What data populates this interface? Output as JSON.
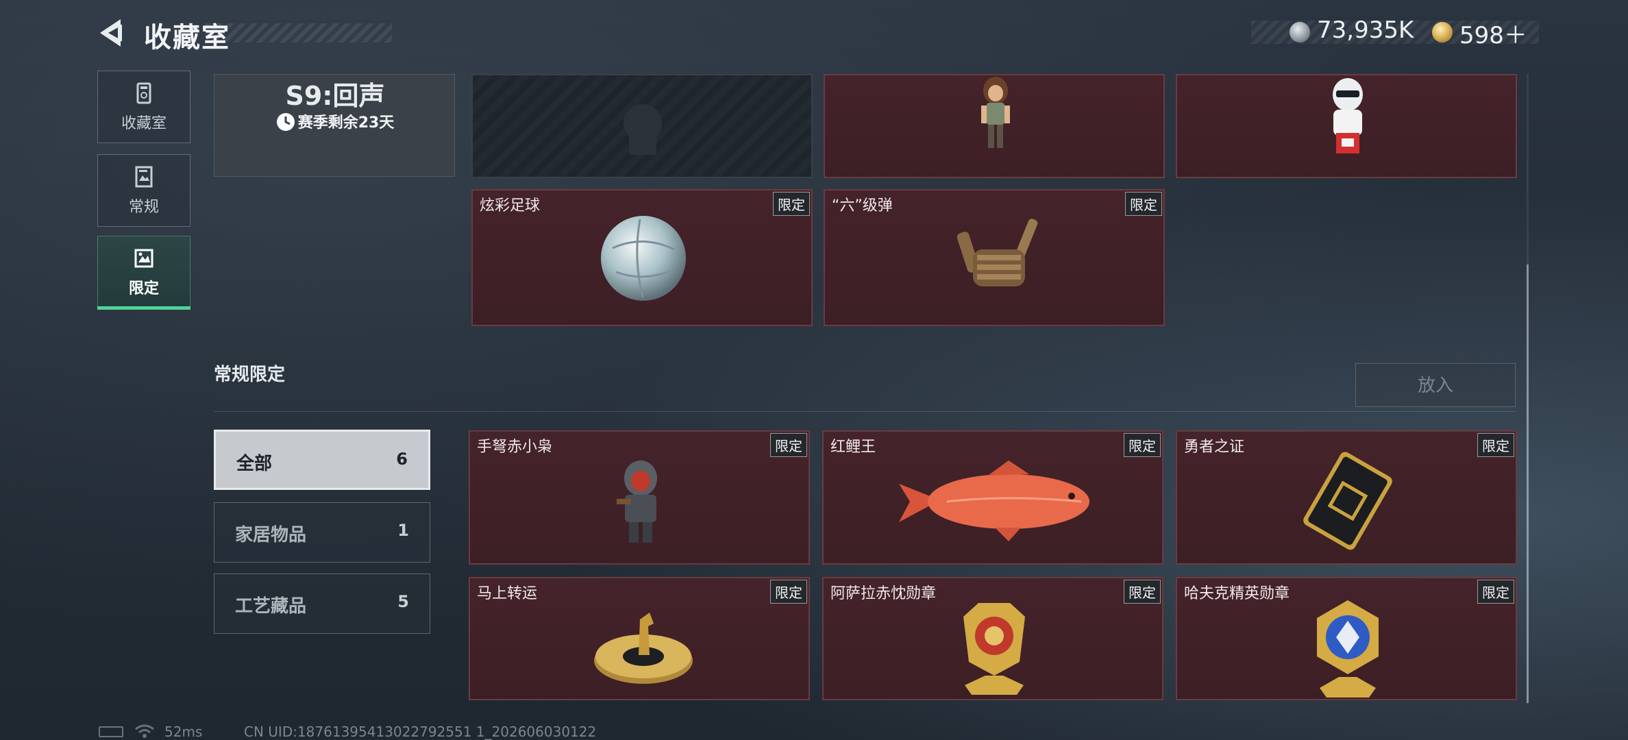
{
  "header": {
    "title": "收藏室",
    "currencies": [
      {
        "icon": "silver-coin-icon",
        "value": "73,935K"
      },
      {
        "icon": "gold-coin-icon",
        "value": "598＋"
      }
    ]
  },
  "nav": {
    "items": [
      {
        "label": "收藏室",
        "icon": "collection-icon"
      },
      {
        "label": "常规",
        "icon": "book-icon"
      },
      {
        "label": "限定",
        "icon": "limited-icon",
        "selected": true
      }
    ]
  },
  "season": {
    "title": "S9:回声",
    "remaining": "赛季剩余23天"
  },
  "season_cards": [
    {
      "name": "炫彩足球",
      "tag": "限定"
    },
    {
      "name": "“六”级弹",
      "tag": "限定"
    }
  ],
  "section": {
    "title": "常规限定",
    "put_button": "放入"
  },
  "filters": [
    {
      "label": "全部",
      "count": "6",
      "selected": true
    },
    {
      "label": "家居物品",
      "count": "1"
    },
    {
      "label": "工艺藏品",
      "count": "5"
    }
  ],
  "items": [
    {
      "name": "手弩赤小枭",
      "tag": "限定"
    },
    {
      "name": "红鲤王",
      "tag": "限定"
    },
    {
      "name": "勇者之证",
      "tag": "限定"
    },
    {
      "name": "马上转运",
      "tag": "限定"
    },
    {
      "name": "阿萨拉赤忱勋章",
      "tag": "限定"
    },
    {
      "name": "哈夫克精英勋章",
      "tag": "限定"
    }
  ],
  "footer": {
    "ping": "52ms",
    "uid": "CN UID:18761395413022792551 1_202606030122"
  },
  "colors": {
    "accent_green": "#4fd39a",
    "card_bg": "#45232a",
    "card_border": "#6a3b40"
  }
}
